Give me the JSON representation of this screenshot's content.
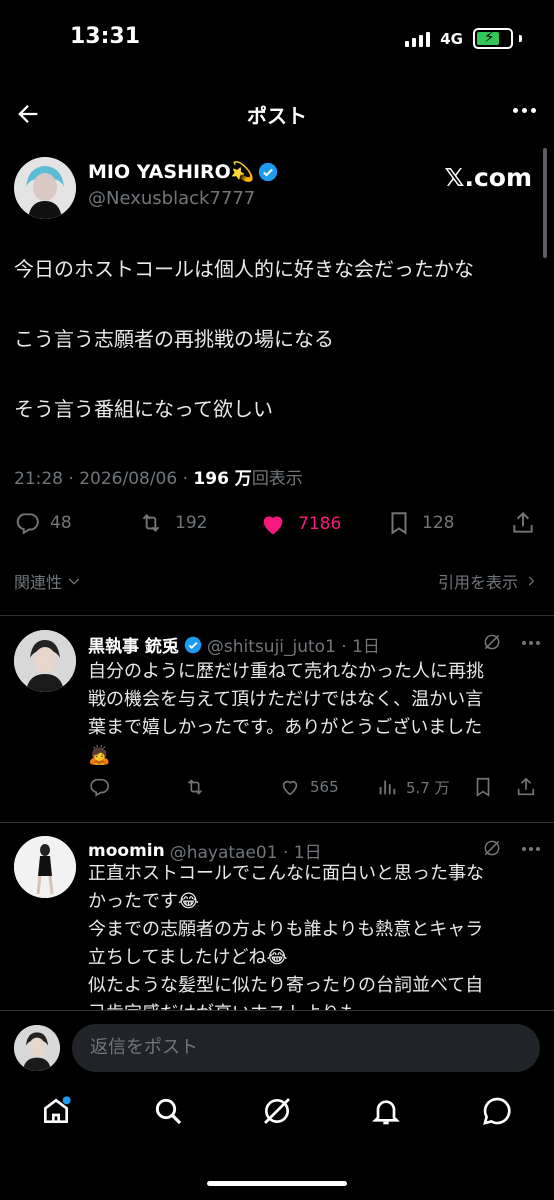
{
  "status": {
    "time": "13:31",
    "network": "4G"
  },
  "header": {
    "title": "ポスト"
  },
  "tweet": {
    "author_name": "MIO YASHIRO💫",
    "handle": "@Nexusblack7777",
    "source_label": "𝕏.com",
    "lines": [
      "今日のホストコールは個人的に好きな会だったかな",
      "こう言う志願者の再挑戦の場になる",
      "そう言う番組になって欲しい"
    ],
    "time": "21:28 · 2026/08/06 · ",
    "views_number": "196 万",
    "views_label": "回表示",
    "replies": "48",
    "reposts": "192",
    "likes": "7186",
    "bookmarks": "128"
  },
  "subbar": {
    "relevance": "関連性",
    "quotes": "引用を表示"
  },
  "replies": [
    {
      "name": "黒執事 銃兎",
      "handle": "@shitsuji_juto1 · 1日",
      "lines": [
        "自分のように歴だけ重ねて売れなかった人に再挑",
        "戦の機会を与えて頂けただけではなく、温かい言",
        "葉まで嬉しかったです。ありがとうございました",
        "🙇"
      ],
      "reply_count": "",
      "repost_count": "",
      "like_count": "565",
      "view_count": "5.7 万"
    },
    {
      "name": "moomin",
      "handle": "@hayatae01 · 1日",
      "lines": [
        "正直ホストコールでこんなに面白いと思った事な",
        "かったです😂",
        "今までの志願者の方よりも誰よりも熱意とキャラ",
        "立ちしてましたけどね😂",
        "似たような髪型に似たり寄ったりの台詞並べて自",
        "己肯定感だけが高いホストよりも"
      ]
    }
  ],
  "composer": {
    "placeholder": "返信をポスト"
  },
  "colors": {
    "like": "#f91880",
    "verified": "#1d9bf0",
    "background": "#000000"
  }
}
